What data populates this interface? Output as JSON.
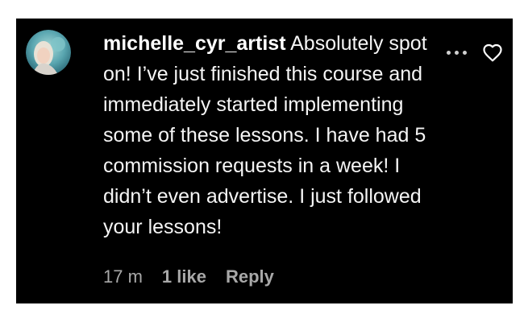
{
  "comment": {
    "username": "michelle_cyr_artist",
    "text": "Absolutely spot on! I’ve just finished this course and immediately started implementing some of these lessons. I have had 5 commission requests in a week! I didn’t even advertise. I just followed your lessons!",
    "timestamp": "17 m",
    "likes_label": "1 like",
    "reply_label": "Reply"
  },
  "icons": {
    "avatar": "avatar-image",
    "more": "more-options-icon",
    "like": "heart-outline-icon"
  },
  "colors": {
    "background": "#000000",
    "text": "#ffffff",
    "meta_text": "#a8a8a8"
  }
}
